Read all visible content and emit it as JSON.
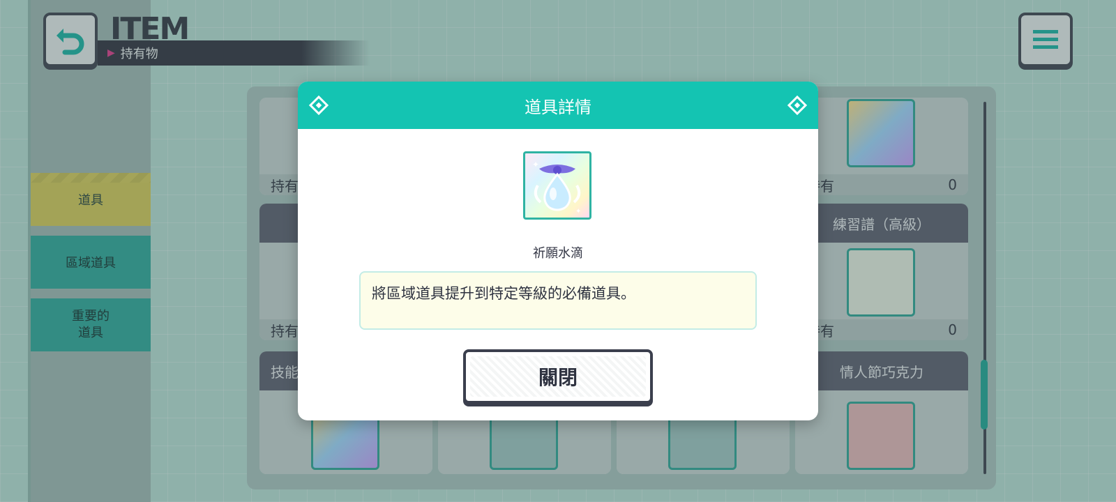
{
  "header": {
    "title": "ITEM",
    "subtitle": "持有物",
    "back_icon": "back-arrow-icon",
    "menu_icon": "hamburger-menu-icon"
  },
  "sidebar": {
    "tabs": [
      {
        "label": "道具",
        "active": true
      },
      {
        "label": "區域道具",
        "active": false
      },
      {
        "label": "重要的",
        "label_line2": "道具",
        "active": false
      }
    ]
  },
  "list": {
    "owned_label": "持有",
    "cards": [
      {
        "name": "",
        "count": ""
      },
      {
        "name": "",
        "count": "0"
      },
      {
        "name": "",
        "count": ""
      },
      {
        "name": "練習譜（高級）",
        "count": "0"
      },
      {
        "name": "技能",
        "count": ""
      },
      {
        "name": "",
        "count": ""
      },
      {
        "name": "",
        "count": ""
      },
      {
        "name": "情人節巧克力",
        "count": ""
      }
    ]
  },
  "modal": {
    "title": "道具詳情",
    "item_name": "祈願水滴",
    "description": "將區域道具提升到特定等級的必備道具。",
    "close_label": "關閉"
  },
  "colors": {
    "accent": "#14c4b2",
    "dark": "#3b3f4d",
    "tab_active": "#d8cd5a",
    "tab_inactive": "#2aa89a"
  }
}
